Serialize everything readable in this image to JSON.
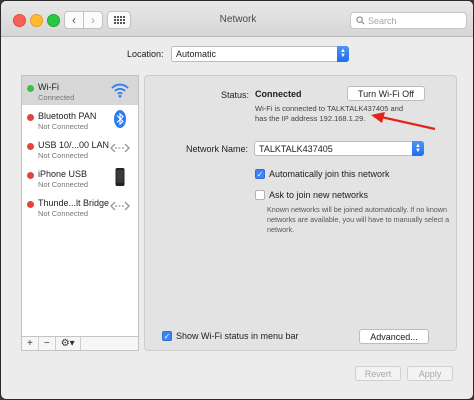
{
  "window": {
    "title": "Network"
  },
  "search": {
    "placeholder": "Search"
  },
  "location": {
    "label": "Location:",
    "value": "Automatic"
  },
  "sidebar": {
    "items": [
      {
        "name": "Wi-Fi",
        "status": "Connected",
        "dot_color": "#3cc04a",
        "icon": "wifi-icon"
      },
      {
        "name": "Bluetooth PAN",
        "status": "Not Connected",
        "dot_color": "#e2453c",
        "icon": "bluetooth-icon"
      },
      {
        "name": "USB 10/...00 LAN",
        "status": "Not Connected",
        "dot_color": "#e2453c",
        "icon": "ethernet-arrows-icon"
      },
      {
        "name": "iPhone USB",
        "status": "Not Connected",
        "dot_color": "#e2453c",
        "icon": "iphone-icon"
      },
      {
        "name": "Thunde...lt Bridge",
        "status": "Not Connected",
        "dot_color": "#e2453c",
        "icon": "ethernet-arrows-icon"
      }
    ],
    "toolbar": {
      "add": "+",
      "remove": "−",
      "gear": "⚙▾"
    }
  },
  "status": {
    "label": "Status:",
    "value": "Connected",
    "button": "Turn Wi-Fi Off",
    "description": "Wi-Fi is connected to TALKTALK437405 and has the IP address 192.168.1.29."
  },
  "network_name": {
    "label": "Network Name:",
    "value": "TALKTALK437405"
  },
  "options": {
    "auto_join": {
      "label": "Automatically join this network",
      "checked": true
    },
    "ask_join": {
      "label": "Ask to join new networks",
      "checked": false,
      "description": "Known networks will be joined automatically. If no known networks are available, you will have to manually select a network."
    }
  },
  "show_status": {
    "label": "Show Wi-Fi status in menu bar",
    "checked": true
  },
  "buttons": {
    "advanced": "Advanced...",
    "revert": "Revert",
    "apply": "Apply"
  },
  "colors": {
    "accent": "#3d82f6",
    "annotation_arrow": "#e2231a"
  }
}
